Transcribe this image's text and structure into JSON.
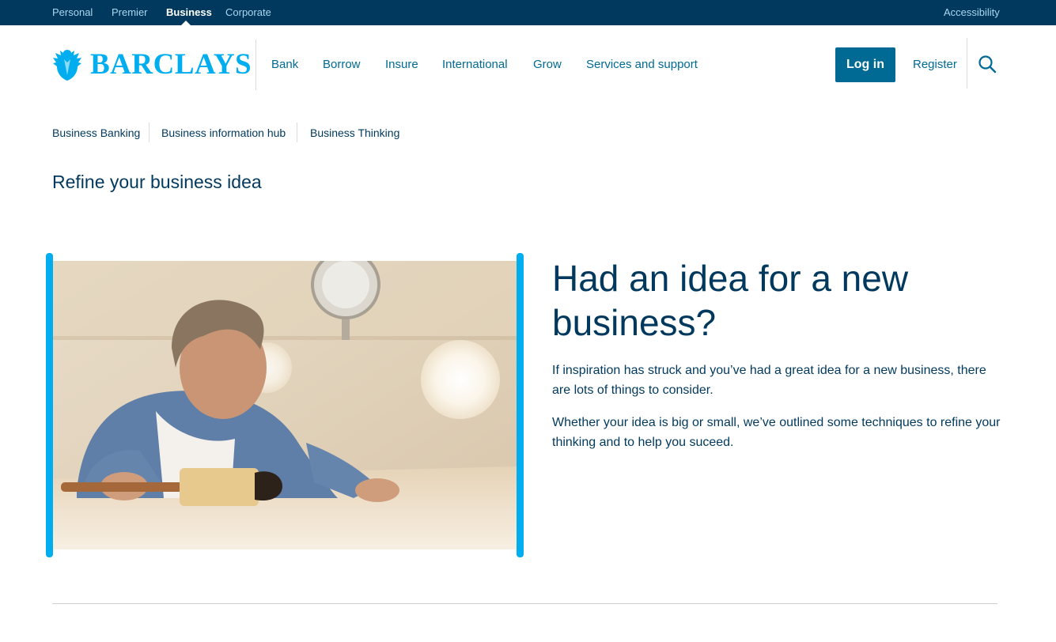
{
  "segments": {
    "items": [
      "Personal",
      "Premier",
      "Business",
      "Corporate"
    ],
    "active": "Business",
    "accessibility": "Accessibility"
  },
  "brand": {
    "name": "BARCLAYS",
    "color": "#00aeef"
  },
  "nav": {
    "items": [
      "Bank",
      "Borrow",
      "Insure",
      "International",
      "Grow",
      "Services and support"
    ],
    "login_label": "Log in",
    "register_label": "Register",
    "search_icon": "search-icon"
  },
  "subnav": {
    "items": [
      "Business Banking",
      "Business information hub",
      "Business Thinking"
    ]
  },
  "page": {
    "title": "Refine your business idea"
  },
  "hero": {
    "heading": "Had an idea for a new business?",
    "paragraphs": [
      "If inspiration has struck and you’ve had a great idea for a new business, there are lots of things to consider.",
      "Whether your idea is big or small, we’ve outlined some techniques to refine your thinking and to help you suceed."
    ]
  },
  "colors": {
    "navy": "#00395d",
    "brand_blue": "#006a94",
    "accent_cyan": "#00aeef"
  }
}
